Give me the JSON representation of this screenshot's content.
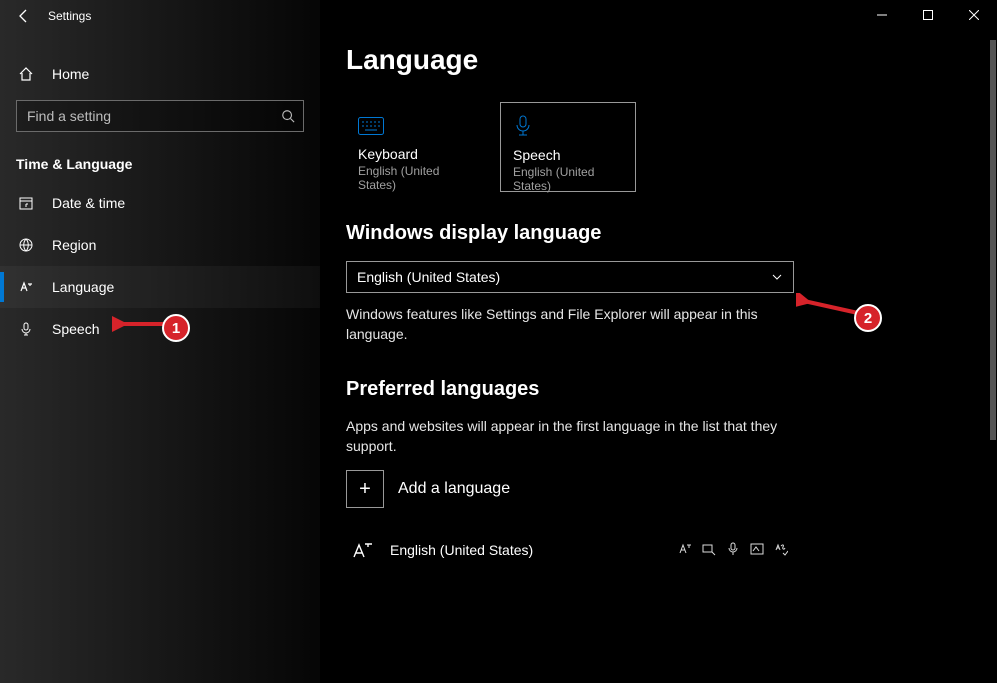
{
  "window": {
    "title": "Settings"
  },
  "sidebar": {
    "home": "Home",
    "search_placeholder": "Find a setting",
    "category": "Time & Language",
    "items": [
      {
        "label": "Date & time"
      },
      {
        "label": "Region"
      },
      {
        "label": "Language"
      },
      {
        "label": "Speech"
      }
    ]
  },
  "page": {
    "heading": "Language",
    "tiles": {
      "keyboard": {
        "title": "Keyboard",
        "subtitle": "English (United States)"
      },
      "speech": {
        "title": "Speech",
        "subtitle": "English (United States)"
      }
    },
    "display_lang_heading": "Windows display language",
    "display_lang_value": "English (United States)",
    "display_lang_help": "Windows features like Settings and File Explorer will appear in this language.",
    "preferred_heading": "Preferred languages",
    "preferred_help": "Apps and websites will appear in the first language in the list that they support.",
    "add_lang_label": "Add a language",
    "languages": [
      {
        "name": "English (United States)"
      }
    ]
  },
  "annotations": {
    "badge1": "1",
    "badge2": "2"
  }
}
